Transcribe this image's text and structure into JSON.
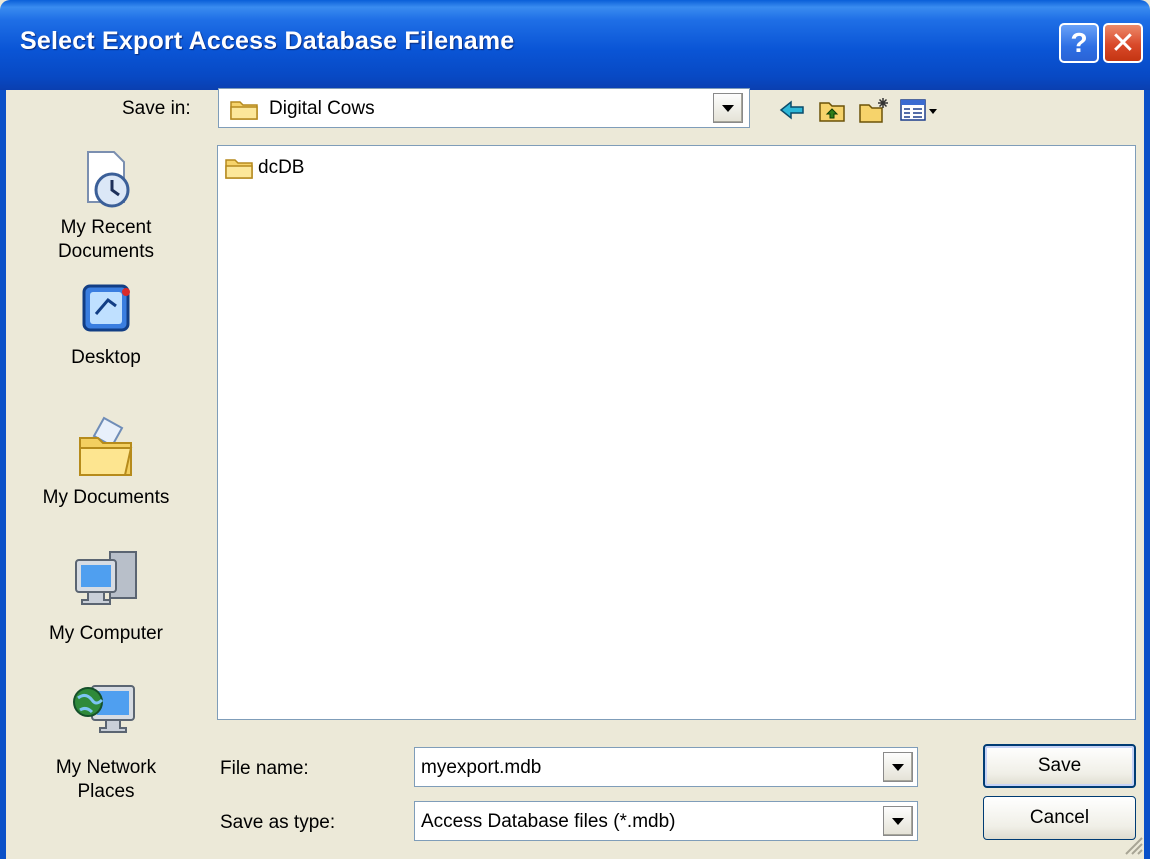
{
  "window": {
    "title": "Select Export Access Database Filename",
    "help_label": "?",
    "close_label": "✕"
  },
  "toolbar": {
    "save_in_label": "Save in:",
    "save_in_mnemonic": "i",
    "save_in_value": "Digital Cows",
    "icons": [
      "back-arrow-icon",
      "up-one-level-icon",
      "create-new-folder-icon",
      "views-menu-icon"
    ]
  },
  "places": [
    {
      "label_lines": [
        "My Recent",
        "Documents"
      ],
      "icon": "recent-documents-icon"
    },
    {
      "label_lines": [
        "Desktop"
      ],
      "icon": "desktop-icon"
    },
    {
      "label_lines": [
        "My Documents"
      ],
      "icon": "my-documents-icon"
    },
    {
      "label_lines": [
        "My Computer"
      ],
      "icon": "my-computer-icon"
    },
    {
      "label_lines": [
        "My Network",
        "Places"
      ],
      "icon": "my-network-places-icon"
    }
  ],
  "files": [
    {
      "name": "dcDB",
      "type": "folder"
    }
  ],
  "form": {
    "file_name_label": "File name:",
    "file_name_value": "myexport.mdb",
    "save_as_type_label": "Save as type:",
    "save_as_type_value": "Access Database files (*.mdb)"
  },
  "buttons": {
    "save": "Save",
    "cancel": "Cancel"
  },
  "colors": {
    "titlebar": "#0a55d6",
    "dialog_bg": "#ece9d8",
    "field_border": "#7f9db9",
    "close_button": "#d9492a"
  }
}
